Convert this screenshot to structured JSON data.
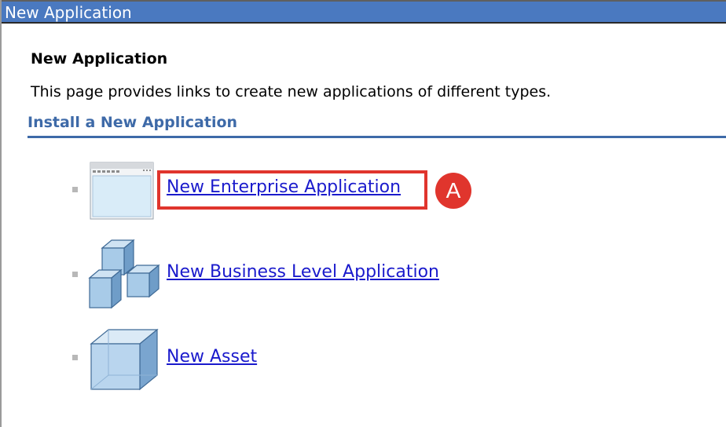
{
  "window": {
    "title": "New Application"
  },
  "page": {
    "heading": "New Application",
    "description": "This page provides links to create new applications of different types."
  },
  "section": {
    "heading": "Install a New Application"
  },
  "applications": [
    {
      "label": "New Enterprise Application",
      "icon": "enterprise-app-window-icon"
    },
    {
      "label": "New Business Level Application",
      "icon": "business-level-cubes-icon"
    },
    {
      "label": "New Asset",
      "icon": "asset-cube-icon"
    }
  ],
  "annotation": {
    "badge_label": "A",
    "color": "#e0352d"
  },
  "colors": {
    "titlebar": "#4a79c0",
    "section_heading": "#3e6aa8",
    "link": "#1a1acc"
  }
}
